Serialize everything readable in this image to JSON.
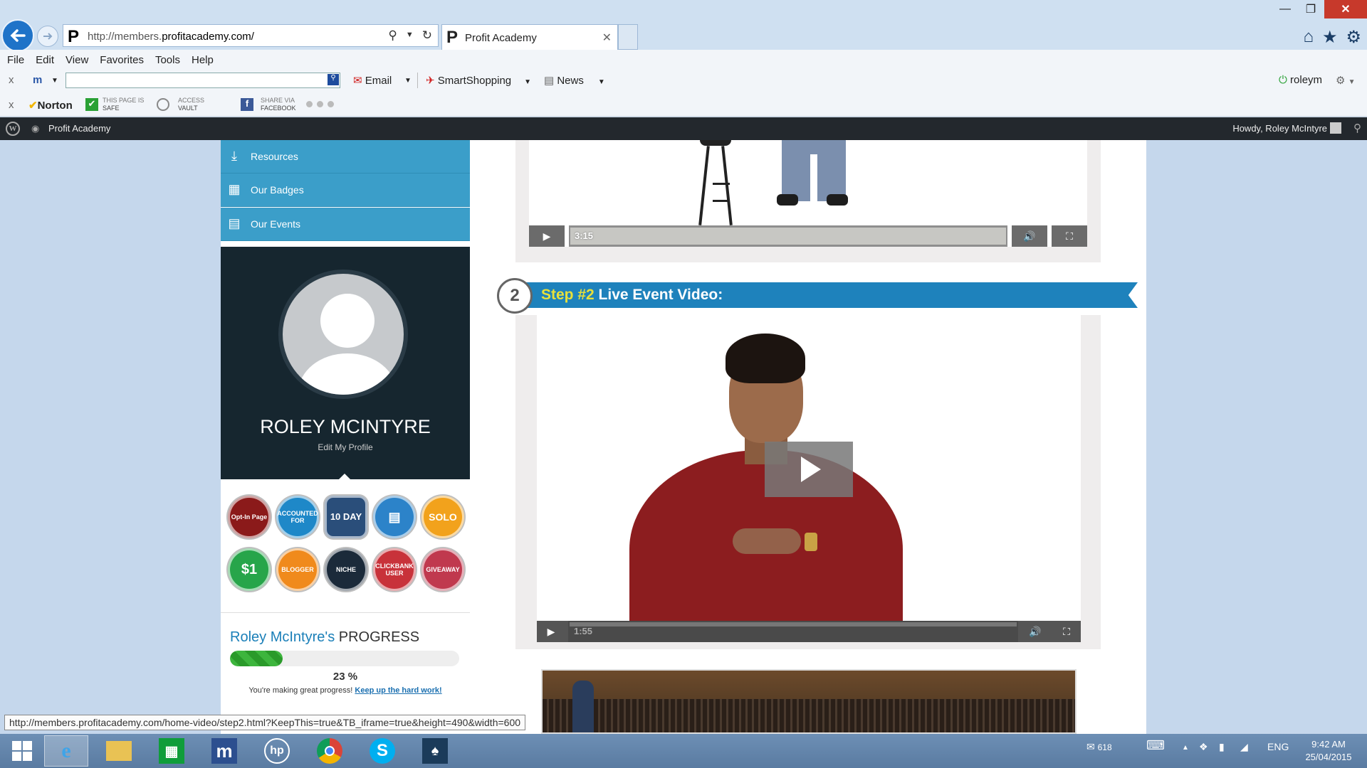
{
  "browser": {
    "url_prefix": "http://members.",
    "url_domain": "profitacademy.com/",
    "tab_title": "Profit Academy",
    "tab_logo": "P",
    "menu": [
      "File",
      "Edit",
      "View",
      "Favorites",
      "Tools",
      "Help"
    ],
    "toolbar1": {
      "close": "x",
      "m_logo": "m",
      "email": "Email",
      "smart_shopping": "SmartShopping",
      "news": "News",
      "user": "roleym"
    },
    "toolbar2": {
      "close": "x",
      "norton": "Norton",
      "safe_line1": "THIS PAGE IS",
      "safe_line2": "SAFE",
      "vault_line1": "ACCESS",
      "vault_line2": "VAULT",
      "fb_line1": "SHARE VIA",
      "fb_line2": "FACEBOOK"
    },
    "status_url": "http://members.profitacademy.com/home-video/step2.html?KeepThis=true&TB_iframe=true&height=490&width=600"
  },
  "wpbar": {
    "site_name": "Profit Academy",
    "howdy": "Howdy, Roley McIntyre"
  },
  "sidebar": {
    "items": [
      {
        "label": "Resources",
        "icon": "download-icon"
      },
      {
        "label": "Our Badges",
        "icon": "qr-icon"
      },
      {
        "label": "Our Events",
        "icon": "calendar-icon"
      }
    ],
    "profile_name": "ROLEY MCINTYRE",
    "edit_profile": "Edit My Profile",
    "badges": [
      {
        "label": "Opt-In Page",
        "color": "#8b1a1a"
      },
      {
        "label": "ACCOUNTED FOR",
        "color": "#1e88c8"
      },
      {
        "label": "10 DAY",
        "color": "#2a4e7a"
      },
      {
        "label": "",
        "color": "#2c83c9"
      },
      {
        "label": "SOLO",
        "color": "#f2a21c"
      },
      {
        "label": "$1",
        "color": "#27a54a"
      },
      {
        "label": "BLOGGER",
        "color": "#f08a1c"
      },
      {
        "label": "NICHE",
        "color": "#1b2a3a"
      },
      {
        "label": "CLICKBANK USER",
        "color": "#c8323a"
      },
      {
        "label": "GIVEAWAY",
        "color": "#c0394e"
      }
    ],
    "progress": {
      "name": "Roley McIntyre's",
      "label": "PROGRESS",
      "percent": 23,
      "percent_text": "23 %",
      "message": "You're making great progress!",
      "link": "Keep up the hard work!"
    }
  },
  "main": {
    "video1_time": "3:15",
    "step_number": "2",
    "step_label": "Step #2",
    "step_title": "Live Event Video:",
    "video2_time": "1:55"
  },
  "taskbar": {
    "mail_count": "618",
    "lang": "ENG",
    "time": "9:42 AM",
    "date": "25/04/2015"
  }
}
